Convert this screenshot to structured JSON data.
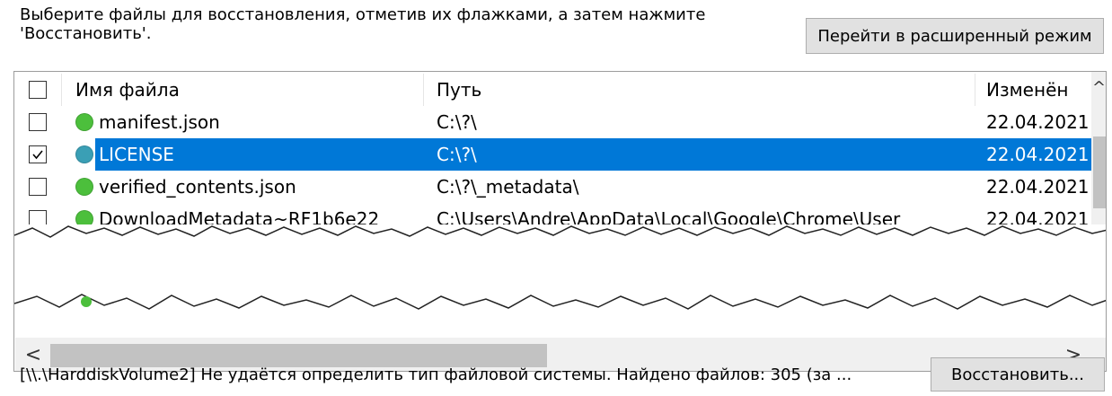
{
  "instructions": "Выберите файлы для восстановления, отметив их флажками, а затем нажмите 'Восстановить'.",
  "advanced_button": "Перейти в расширенный режим",
  "columns": {
    "name": "Имя файла",
    "path": "Путь",
    "modified": "Изменён"
  },
  "rows": [
    {
      "name": "manifest.json",
      "path": "C:\\?\\",
      "modified": "22.04.2021",
      "checked": false,
      "selected": false,
      "dot_color": "#4cbf3c"
    },
    {
      "name": "LICENSE",
      "path": "C:\\?\\",
      "modified": "22.04.2021",
      "checked": true,
      "selected": true,
      "dot_color": "#3a9fb5"
    },
    {
      "name": "verified_contents.json",
      "path": "C:\\?\\_metadata\\",
      "modified": "22.04.2021",
      "checked": false,
      "selected": false,
      "dot_color": "#4cbf3c"
    },
    {
      "name": "DownloadMetadata~RF1b6e22",
      "path": "C:\\Users\\Andre\\AppData\\Local\\Google\\Chrome\\User",
      "modified": "22.04.2021",
      "checked": false,
      "selected": false,
      "dot_color": "#4cbf3c"
    }
  ],
  "scroll_left_glyph": "<",
  "scroll_right_glyph": ">",
  "scroll_up_glyph": "^",
  "status_text": "[\\\\.\\HarddiskVolume2] Не удаётся определить тип файловой системы. Найдено файлов: 305 (за ...",
  "restore_button": "Восстановить...",
  "colors": {
    "selection": "#0078d7",
    "button_bg": "#e1e1e1",
    "ok_dot": "#4cbf3c"
  }
}
